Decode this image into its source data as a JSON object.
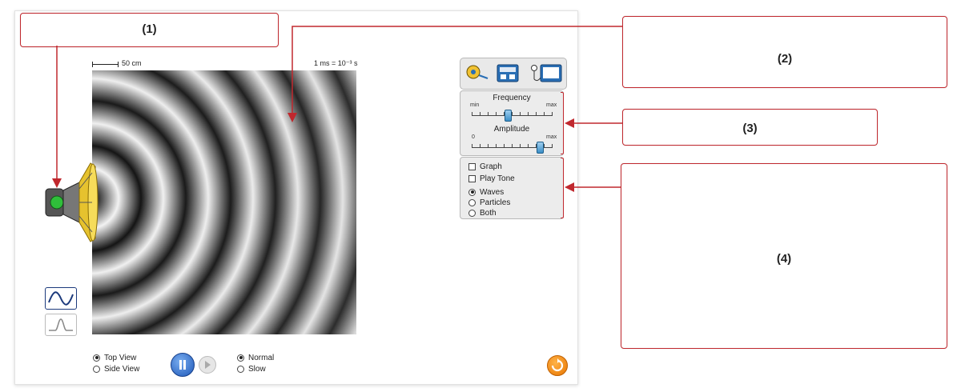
{
  "scale": {
    "length_label": "50 cm",
    "time_label": "1 ms = 10⁻³ s"
  },
  "view": {
    "options": [
      "Top View",
      "Side View"
    ],
    "selected": "Top View"
  },
  "speed": {
    "options": [
      "Normal",
      "Slow"
    ],
    "selected": "Normal"
  },
  "controls": {
    "frequency": {
      "label": "Frequency",
      "min_label": "min",
      "max_label": "max",
      "level": 0.45
    },
    "amplitude": {
      "label": "Amplitude",
      "min_label": "0",
      "max_label": "max",
      "level": 0.85
    }
  },
  "options_panel": {
    "checkboxes": [
      {
        "label": "Graph",
        "checked": false
      },
      {
        "label": "Play Tone",
        "checked": false
      }
    ],
    "radios": [
      {
        "label": "Waves",
        "selected": true
      },
      {
        "label": "Particles",
        "selected": false
      },
      {
        "label": "Both",
        "selected": false
      }
    ]
  },
  "callouts": [
    "(1)",
    "(2)",
    "(3)",
    "(4)"
  ],
  "colors": {
    "callout_red": "#c0282e",
    "play_blue": "#1d57b8",
    "reset_orange": "#e87500",
    "speaker_gold": "#e6c22e"
  }
}
